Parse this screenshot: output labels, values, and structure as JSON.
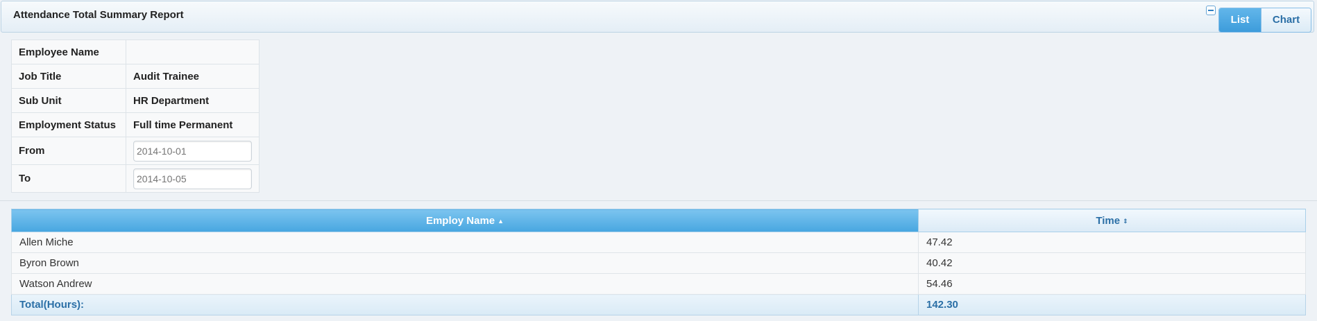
{
  "header": {
    "title": "Attendance Total Summary Report",
    "view_buttons": {
      "list": "List",
      "chart": "Chart"
    }
  },
  "filters": {
    "employee_name": {
      "label": "Employee Name",
      "value": ""
    },
    "job_title": {
      "label": "Job Title",
      "value": "Audit Trainee"
    },
    "sub_unit": {
      "label": "Sub Unit",
      "value": "HR Department"
    },
    "employment_status": {
      "label": "Employment Status",
      "value": "Full time Permanent"
    },
    "from": {
      "label": "From",
      "placeholder": "2014-10-01"
    },
    "to": {
      "label": "To",
      "placeholder": "2014-10-05"
    }
  },
  "table": {
    "columns": [
      {
        "label": "Employ Name",
        "sort": "asc"
      },
      {
        "label": "Time",
        "sort": "none"
      }
    ],
    "rows": [
      {
        "name": "Allen Miche",
        "time": "47.42"
      },
      {
        "name": "Byron Brown",
        "time": "40.42"
      },
      {
        "name": "Watson Andrew",
        "time": "54.46"
      }
    ],
    "total": {
      "label": "Total(Hours):",
      "value": "142.30"
    }
  },
  "colors": {
    "accent": "#47a6e0",
    "link": "#2b6fa6"
  },
  "icons": {
    "collapse": "minus-icon",
    "sort_asc": "sort-asc-icon",
    "sort_both": "sort-both-icon"
  }
}
